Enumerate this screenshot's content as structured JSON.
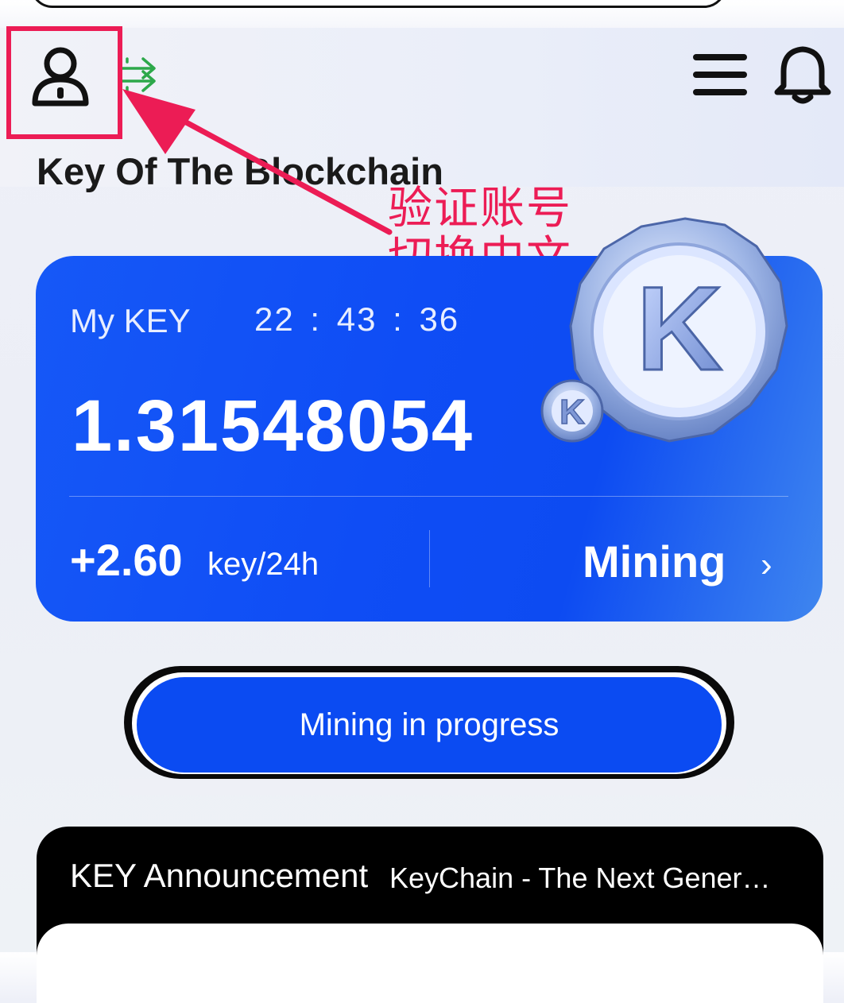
{
  "header": {
    "title": "Key Of The Blockchain",
    "icons": [
      "user-icon",
      "transfer-icon",
      "menu-icon",
      "bell-icon"
    ]
  },
  "annotation": {
    "line1": "验证账号",
    "line2": "切换中文",
    "color": "#ec1c55"
  },
  "card": {
    "label": "My KEY",
    "timer": "22 : 43 : 36",
    "balance": "1.31548054",
    "rate": "+2.60",
    "rate_unit": "key/24h",
    "action_label": "Mining",
    "chevron": "›",
    "coin_letter": "K"
  },
  "progress_button": {
    "label": "Mining in progress"
  },
  "announcement": {
    "title": "KEY Announcement",
    "text": "KeyChain - The Next Gener…"
  },
  "colors": {
    "accent": "#0b4bf2",
    "annotation": "#ec1c55"
  }
}
